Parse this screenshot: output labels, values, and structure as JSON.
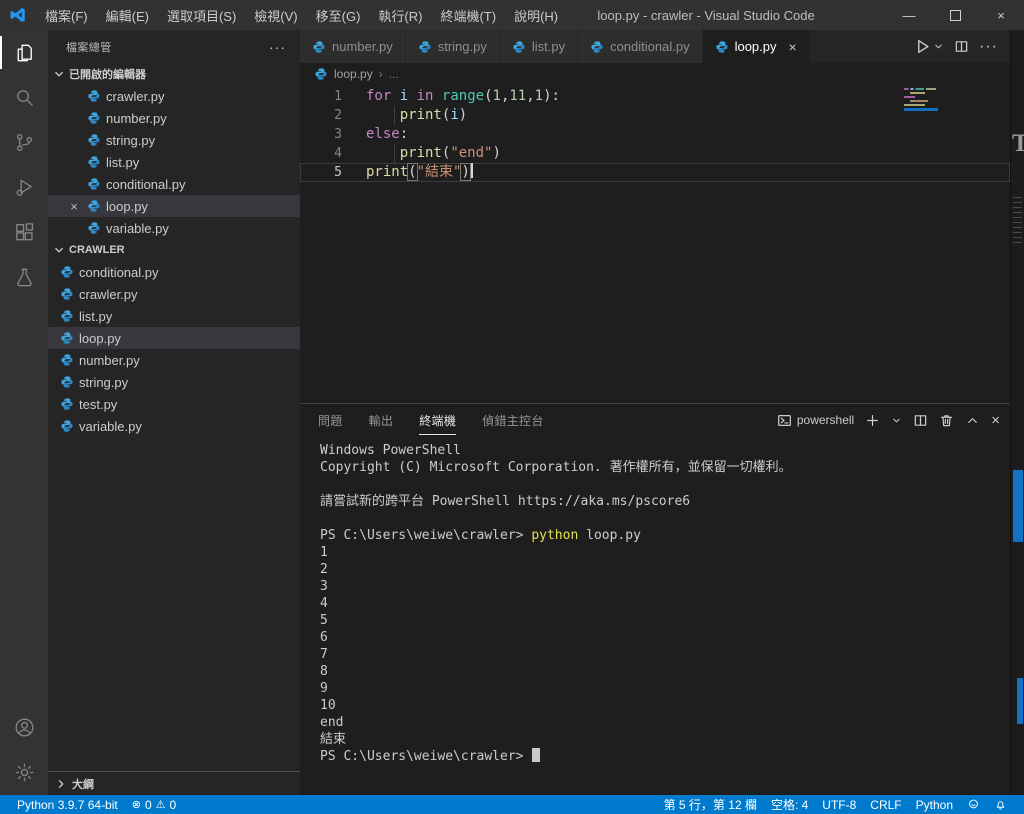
{
  "title_bar": {
    "title": "loop.py - crawler - Visual Studio Code",
    "menus": [
      {
        "key": "file",
        "label": "檔案(F)"
      },
      {
        "key": "edit",
        "label": "編輯(E)"
      },
      {
        "key": "selection",
        "label": "選取項目(S)"
      },
      {
        "key": "view",
        "label": "檢視(V)"
      },
      {
        "key": "go",
        "label": "移至(G)"
      },
      {
        "key": "run",
        "label": "執行(R)"
      },
      {
        "key": "terminal",
        "label": "終端機(T)"
      },
      {
        "key": "help",
        "label": "說明(H)"
      }
    ]
  },
  "sidebar": {
    "title": "檔案總管",
    "open_editors_label": "已開啟的編輯器",
    "open_editors": [
      {
        "name": "crawler.py"
      },
      {
        "name": "number.py"
      },
      {
        "name": "string.py"
      },
      {
        "name": "list.py"
      },
      {
        "name": "conditional.py"
      },
      {
        "name": "loop.py",
        "selected": true,
        "close": "×"
      },
      {
        "name": "variable.py"
      }
    ],
    "folder_label": "CRAWLER",
    "files": [
      {
        "name": "conditional.py"
      },
      {
        "name": "crawler.py"
      },
      {
        "name": "list.py"
      },
      {
        "name": "loop.py",
        "selected": true
      },
      {
        "name": "number.py"
      },
      {
        "name": "string.py"
      },
      {
        "name": "test.py"
      },
      {
        "name": "variable.py"
      }
    ],
    "outline_label": "大綱"
  },
  "editor": {
    "tabs": [
      {
        "label": "number.py"
      },
      {
        "label": "string.py"
      },
      {
        "label": "list.py"
      },
      {
        "label": "conditional.py"
      },
      {
        "label": "loop.py",
        "active": true,
        "close": "×"
      }
    ],
    "breadcrumb": {
      "file": "loop.py",
      "sep": "›",
      "more": "..."
    },
    "code": {
      "lines": [
        {
          "num": "1",
          "tokens": [
            [
              "kw",
              "for"
            ],
            [
              "pn",
              " "
            ],
            [
              "var",
              "i"
            ],
            [
              "pn",
              " "
            ],
            [
              "kw",
              "in"
            ],
            [
              "pn",
              " "
            ],
            [
              "cls",
              "range"
            ],
            [
              "pn",
              "("
            ],
            [
              "num",
              "1"
            ],
            [
              "pn",
              ","
            ],
            [
              "num",
              "11"
            ],
            [
              "pn",
              ","
            ],
            [
              "num",
              "1"
            ],
            [
              "pn",
              "):"
            ]
          ]
        },
        {
          "num": "2",
          "guide": true,
          "tokens": [
            [
              "pn",
              "    "
            ],
            [
              "fn",
              "print"
            ],
            [
              "pn",
              "("
            ],
            [
              "var",
              "i"
            ],
            [
              "pn",
              ")"
            ]
          ]
        },
        {
          "num": "3",
          "tokens": [
            [
              "kw",
              "else"
            ],
            [
              "pn",
              ":"
            ]
          ]
        },
        {
          "num": "4",
          "guide": true,
          "tokens": [
            [
              "pn",
              "    "
            ],
            [
              "fn",
              "print"
            ],
            [
              "pn",
              "("
            ],
            [
              "str",
              "\"end\""
            ],
            [
              "pn",
              ")"
            ]
          ]
        },
        {
          "num": "5",
          "current": true,
          "cursor": true,
          "tokens": [
            [
              "fn",
              "print"
            ],
            [
              "pnb",
              "("
            ],
            [
              "str",
              "\"結束\""
            ],
            [
              "pnb",
              ")"
            ]
          ]
        }
      ]
    }
  },
  "panel": {
    "tabs": [
      {
        "label": "問題"
      },
      {
        "label": "輸出"
      },
      {
        "label": "終端機",
        "active": true
      },
      {
        "label": "偵錯主控台"
      }
    ],
    "terminal_name": "powershell",
    "terminal": {
      "lines": [
        {
          "tokens": [
            [
              "d",
              "Windows PowerShell"
            ]
          ]
        },
        {
          "tokens": [
            [
              "d",
              "Copyright (C) Microsoft Corporation. 著作權所有，並保留一切權利。"
            ]
          ]
        },
        {
          "tokens": []
        },
        {
          "tokens": [
            [
              "d",
              "請嘗試新的跨平台 PowerShell https://aka.ms/pscore6"
            ]
          ]
        },
        {
          "tokens": []
        },
        {
          "tokens": [
            [
              "d",
              "PS C:\\Users\\weiwe\\crawler> "
            ],
            [
              "y",
              "python"
            ],
            [
              "d",
              " loop.py"
            ]
          ]
        },
        {
          "tokens": [
            [
              "d",
              "1"
            ]
          ]
        },
        {
          "tokens": [
            [
              "d",
              "2"
            ]
          ]
        },
        {
          "tokens": [
            [
              "d",
              "3"
            ]
          ]
        },
        {
          "tokens": [
            [
              "d",
              "4"
            ]
          ]
        },
        {
          "tokens": [
            [
              "d",
              "5"
            ]
          ]
        },
        {
          "tokens": [
            [
              "d",
              "6"
            ]
          ]
        },
        {
          "tokens": [
            [
              "d",
              "7"
            ]
          ]
        },
        {
          "tokens": [
            [
              "d",
              "8"
            ]
          ]
        },
        {
          "tokens": [
            [
              "d",
              "9"
            ]
          ]
        },
        {
          "tokens": [
            [
              "d",
              "10"
            ]
          ]
        },
        {
          "tokens": [
            [
              "d",
              "end"
            ]
          ]
        },
        {
          "tokens": [
            [
              "d",
              "結束"
            ]
          ]
        },
        {
          "cursor": true,
          "tokens": [
            [
              "d",
              "PS C:\\Users\\weiwe\\crawler> "
            ]
          ]
        }
      ]
    }
  },
  "status": {
    "python_version": "Python 3.9.7 64-bit",
    "problems": {
      "errors": "0",
      "warnings": "0"
    },
    "line_col": "第 5 行，第 12 欄",
    "spaces": "空格: 4",
    "encoding": "UTF-8",
    "eol": "CRLF",
    "language": "Python"
  },
  "background_window": {
    "letter": "T"
  },
  "colors": {
    "accent": "#007acc",
    "selection": "#37373d",
    "editor_bg": "#1e1e1e",
    "sidebar_bg": "#252526"
  }
}
